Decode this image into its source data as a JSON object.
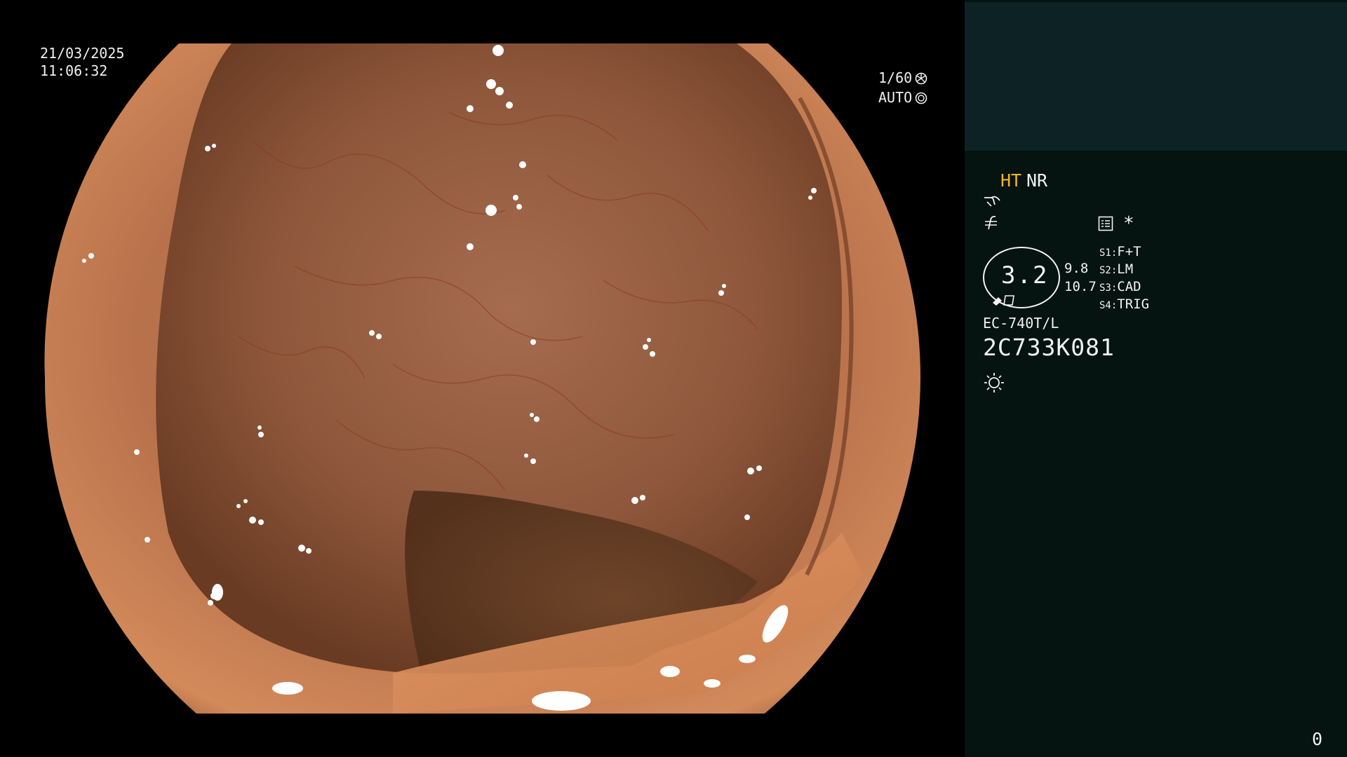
{
  "overlay": {
    "date": "21/03/2025",
    "time": "11:06:32",
    "shutter": "1/60",
    "iris": "AUTO"
  },
  "panel": {
    "mode_ht": "HT",
    "mode_nr": "NR",
    "mode_ht_color": "#f5b324",
    "zoom_value": "3.2",
    "zoom_a": "9.8",
    "zoom_b": "10.7",
    "presets": [
      {
        "key": "S1:",
        "value": "F+T"
      },
      {
        "key": "S2:",
        "value": "LM"
      },
      {
        "key": "S3:",
        "value": "CAD"
      },
      {
        "key": "S4:",
        "value": "TRIG"
      }
    ],
    "asterisk": "*",
    "scope_model": "EC-740T/L",
    "scope_serial": "2C733K081",
    "counter": "0",
    "icons": [
      "enhancement-curve-icon",
      "filter-symbol-icon",
      "menu-list-icon",
      "shutter-icon",
      "iris-icon",
      "zoom-marker-icon",
      "light-source-icon"
    ]
  }
}
